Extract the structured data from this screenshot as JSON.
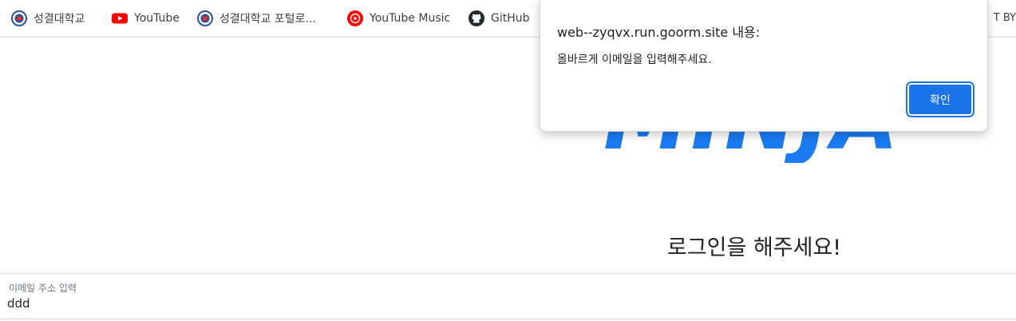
{
  "bookmarks": {
    "items": [
      {
        "label": "성결대학교",
        "icon": "university-emblem-icon"
      },
      {
        "label": "YouTube",
        "icon": "youtube-icon"
      },
      {
        "label": "성결대학교 포털로...",
        "icon": "university-emblem-icon"
      },
      {
        "label": "YouTube Music",
        "icon": "youtube-music-icon"
      },
      {
        "label": "GitHub",
        "icon": "github-icon"
      }
    ],
    "overflow_fragment": "T BY"
  },
  "page": {
    "logo_fragment": "MINJA",
    "heading": "로그인을 해주세요!",
    "email": {
      "label": "이메일 주소 입력",
      "value": "ddd"
    }
  },
  "dialog": {
    "title": "web--zyqvx.run.goorm.site 내용:",
    "message": "올바르게 이메일을 입력해주세요.",
    "ok_label": "확인"
  },
  "colors": {
    "accent": "#1a73e8",
    "logo": "#1a7bf3",
    "youtube_red": "#ff0000"
  }
}
